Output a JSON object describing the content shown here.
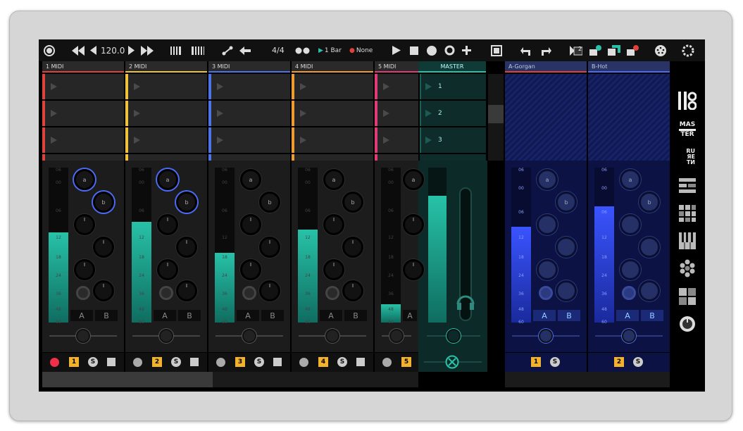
{
  "toolbar": {
    "tempo": "120.0",
    "time_signature": "4/4",
    "launch_quantize": "1 Bar",
    "record_quantize": "None",
    "scene_count_badge": "2"
  },
  "tracks": [
    {
      "name": "1 MIDI",
      "color": "#e0413a",
      "number": "1",
      "level": 0.58,
      "sends": [
        "a",
        "b"
      ],
      "abutton": "A",
      "bbutton": "B",
      "armed": true
    },
    {
      "name": "2 MIDI",
      "color": "#f0c23a",
      "number": "2",
      "level": 0.65,
      "sends": [
        "a",
        "b"
      ],
      "abutton": "A",
      "bbutton": "B",
      "armed": false
    },
    {
      "name": "3 MIDI",
      "color": "#4a74e8",
      "number": "3",
      "level": 0.45,
      "sends": [
        "a",
        "b"
      ],
      "abutton": "A",
      "bbutton": "B",
      "armed": false
    },
    {
      "name": "4 MIDI",
      "color": "#f09a32",
      "number": "4",
      "level": 0.6,
      "sends": [
        "a",
        "b"
      ],
      "abutton": "A",
      "bbutton": "B",
      "armed": false
    },
    {
      "name": "5 MIDI",
      "color": "#e23a78",
      "number": "5",
      "level": 0.12,
      "sends": [
        "a",
        "b"
      ],
      "abutton": "A",
      "bbutton": "B",
      "armed": false
    }
  ],
  "master": {
    "name": "MASTER",
    "scenes": [
      "1",
      "2",
      "3"
    ],
    "level": 0.82
  },
  "returns": [
    {
      "name": "A-Gorgan",
      "number": "1",
      "level": 0.62,
      "sends": [
        "a",
        "b"
      ],
      "abutton": "A",
      "bbutton": "B"
    },
    {
      "name": "B-Hot",
      "number": "2",
      "level": 0.75,
      "sends": [
        "a",
        "b"
      ],
      "abutton": "A",
      "bbutton": "B"
    }
  ],
  "meter_scale": [
    "06",
    "00",
    "06",
    "12",
    "18",
    "24",
    "36",
    "48",
    "60"
  ],
  "solo_label": "S",
  "sidebar": {
    "master_line1": "MAS",
    "master_line2": "TER",
    "return_line1": "RU",
    "return_line2": "ЯЕ",
    "return_line3": "ТИ"
  },
  "colors": {
    "accent_teal": "#27c2a8",
    "return_blue": "#3a54ff",
    "number_badge": "#f2b22b",
    "send_ring": "#4a6cf5"
  }
}
